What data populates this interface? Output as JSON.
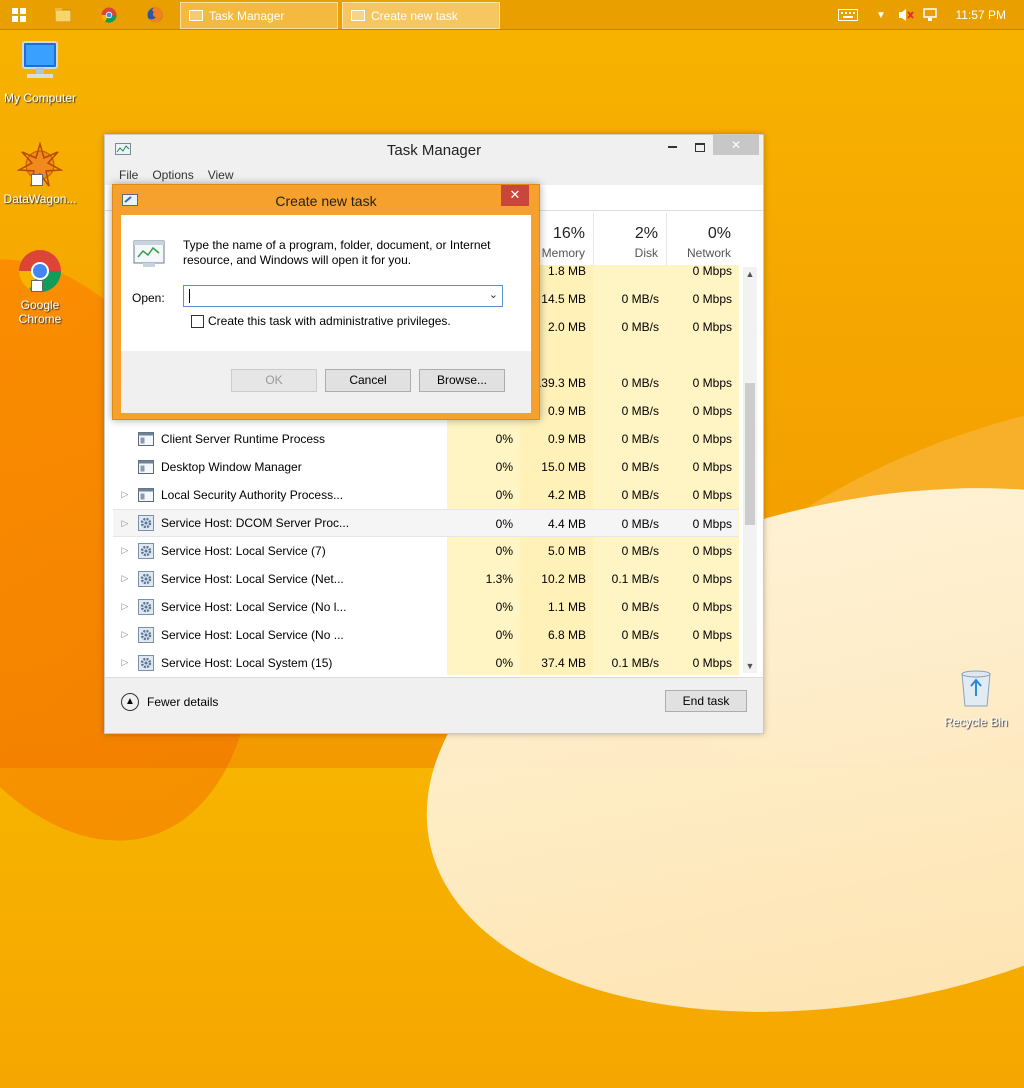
{
  "taskbar": {
    "buttons": [
      {
        "label": "Task Manager"
      },
      {
        "label": "Create new task"
      }
    ],
    "clock": "11:57 PM"
  },
  "desktop": {
    "icons": [
      {
        "label": "My Computer"
      },
      {
        "label": "DataWagon..."
      },
      {
        "label": "Google Chrome"
      },
      {
        "label": "Recycle Bin"
      }
    ]
  },
  "task_manager": {
    "title": "Task Manager",
    "menu": [
      "File",
      "Options",
      "View"
    ],
    "columns": [
      {
        "pct": "16%",
        "label": "Memory"
      },
      {
        "pct": "2%",
        "label": "Disk"
      },
      {
        "pct": "0%",
        "label": "Network"
      }
    ],
    "rows": [
      {
        "name": "",
        "cpu": "",
        "mem": "1.8 MB",
        "disk": "",
        "net": "0 Mbps",
        "expand": false
      },
      {
        "name": "",
        "cpu": "",
        "mem": "14.5 MB",
        "disk": "0 MB/s",
        "net": "0 Mbps",
        "expand": false
      },
      {
        "name": "",
        "cpu": "",
        "mem": "2.0 MB",
        "disk": "0 MB/s",
        "net": "0 Mbps",
        "expand": false
      },
      {
        "name": "",
        "cpu": "",
        "mem": "",
        "disk": "",
        "net": "",
        "expand": false
      },
      {
        "name": "",
        "cpu": "",
        "mem": "139.3 MB",
        "disk": "0 MB/s",
        "net": "0 Mbps",
        "expand": false
      },
      {
        "name": "",
        "cpu": "",
        "mem": "0.9 MB",
        "disk": "0 MB/s",
        "net": "0 Mbps",
        "expand": false
      },
      {
        "name": "Client Server Runtime Process",
        "cpu": "0%",
        "mem": "0.9 MB",
        "disk": "0 MB/s",
        "net": "0 Mbps",
        "expand": false
      },
      {
        "name": "Desktop Window Manager",
        "cpu": "0%",
        "mem": "15.0 MB",
        "disk": "0 MB/s",
        "net": "0 Mbps",
        "expand": false
      },
      {
        "name": "Local Security Authority Process...",
        "cpu": "0%",
        "mem": "4.2 MB",
        "disk": "0 MB/s",
        "net": "0 Mbps",
        "expand": true
      },
      {
        "name": "Service Host: DCOM Server Proc...",
        "cpu": "0%",
        "mem": "4.4 MB",
        "disk": "0 MB/s",
        "net": "0 Mbps",
        "expand": true,
        "selected": true
      },
      {
        "name": "Service Host: Local Service (7)",
        "cpu": "0%",
        "mem": "5.0 MB",
        "disk": "0 MB/s",
        "net": "0 Mbps",
        "expand": true
      },
      {
        "name": "Service Host: Local Service (Net...",
        "cpu": "1.3%",
        "mem": "10.2 MB",
        "disk": "0.1 MB/s",
        "net": "0 Mbps",
        "expand": true
      },
      {
        "name": "Service Host: Local Service (No l...",
        "cpu": "0%",
        "mem": "1.1 MB",
        "disk": "0 MB/s",
        "net": "0 Mbps",
        "expand": true
      },
      {
        "name": "Service Host: Local Service (No ...",
        "cpu": "0%",
        "mem": "6.8 MB",
        "disk": "0 MB/s",
        "net": "0 Mbps",
        "expand": true
      },
      {
        "name": "Service Host: Local System (15)",
        "cpu": "0%",
        "mem": "37.4 MB",
        "disk": "0.1 MB/s",
        "net": "0 Mbps",
        "expand": true
      }
    ],
    "footer": {
      "fewer_details": "Fewer details",
      "end_task": "End task"
    }
  },
  "dialog": {
    "title": "Create new task",
    "description": "Type the name of a program, folder, document, or Internet resource, and Windows will open it for you.",
    "open_label": "Open:",
    "open_value": "",
    "admin_checkbox": "Create this task with administrative privileges.",
    "admin_checked": false,
    "ok": "OK",
    "cancel": "Cancel",
    "browse": "Browse..."
  }
}
